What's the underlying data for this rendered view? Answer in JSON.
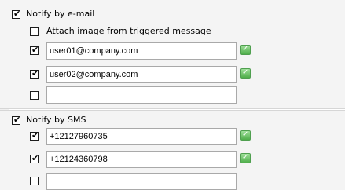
{
  "email": {
    "header_label": "Notify by e-mail",
    "header_checked": true,
    "attach_label": "Attach image from triggered message",
    "attach_checked": false,
    "rows": [
      {
        "checked": true,
        "value": "user01@company.com",
        "valid": true
      },
      {
        "checked": true,
        "value": "user02@company.com",
        "valid": true
      },
      {
        "checked": false,
        "value": "",
        "valid": false
      }
    ]
  },
  "sms": {
    "header_label": "Notify by SMS",
    "header_checked": true,
    "rows": [
      {
        "checked": true,
        "value": "+12127960735",
        "valid": true
      },
      {
        "checked": true,
        "value": "+12124360798",
        "valid": true
      },
      {
        "checked": false,
        "value": "",
        "valid": false
      }
    ]
  },
  "icons": {
    "checkmark_glyph": "✔",
    "valid_glyph": "✓",
    "valid_color": "#4fae4a"
  }
}
